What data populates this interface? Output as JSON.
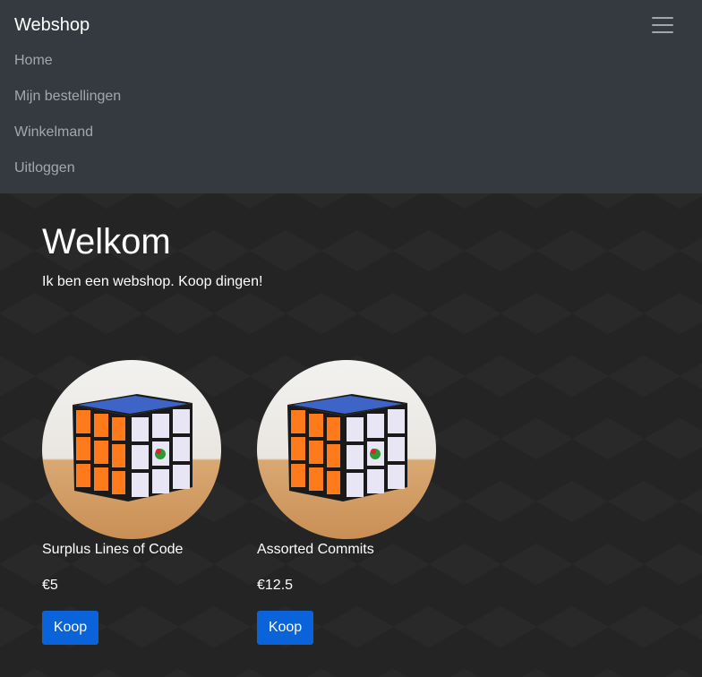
{
  "navbar": {
    "brand": "Webshop",
    "toggler_icon": "hamburger-menu-icon",
    "links": [
      {
        "label": "Home"
      },
      {
        "label": "Mijn bestellingen"
      },
      {
        "label": "Winkelmand"
      },
      {
        "label": "Uitloggen"
      }
    ]
  },
  "hero": {
    "title": "Welkom",
    "subtitle": "Ik ben een webshop. Koop dingen!"
  },
  "products": [
    {
      "name": "Surplus Lines of Code",
      "price": "€5",
      "button_label": "Koop"
    },
    {
      "name": "Assorted Commits",
      "price": "€12.5",
      "button_label": "Koop"
    }
  ],
  "colors": {
    "navbar_bg": "#343a40",
    "page_bg": "#242424",
    "button_bg": "#0a63d8"
  }
}
